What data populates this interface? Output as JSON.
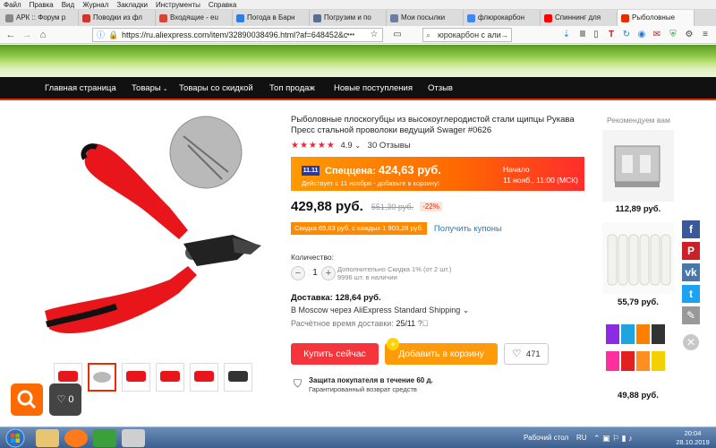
{
  "menubar": [
    "Файл",
    "Правка",
    "Вид",
    "Журнал",
    "Закладки",
    "Инструменты",
    "Справка"
  ],
  "tabs": [
    {
      "label": "АРК :: Форум р",
      "color": "#888888",
      "active": false
    },
    {
      "label": "Поводки из фл",
      "color": "#d0342c",
      "active": false
    },
    {
      "label": "Входящие - eu",
      "color": "#d44638",
      "active": false
    },
    {
      "label": "Погода в Барн",
      "color": "#2f7de1",
      "active": false
    },
    {
      "label": "Погрузим и по",
      "color": "#5a6f8f",
      "active": false
    },
    {
      "label": "Мои посылки",
      "color": "#6a7f9f",
      "active": false
    },
    {
      "label": "флюрокарбон",
      "color": "#4285f4",
      "active": false
    },
    {
      "label": "Спиннинг для",
      "color": "#ff0000",
      "active": false
    },
    {
      "label": "Рыболовные",
      "color": "#e62e04",
      "active": true
    }
  ],
  "browser": {
    "url": "https://ru.aliexpress.com/item/32890038496.html?af=648452&c",
    "search": "юрокарбон с али",
    "back": "←",
    "forward": "→",
    "home": "⌂",
    "more": "•••",
    "star": "☆"
  },
  "nav": [
    "Главная страница",
    "Товары",
    "Товары со скидкой",
    "Топ продаж",
    "Новые поступления",
    "Отзыв"
  ],
  "product": {
    "title": "Рыболовные плоскогубцы из высокоуглеродистой стали щипцы Рукава Пресс стальной проволоки ведущий Swager #0626",
    "stars": "★★★★★",
    "rating": "4.9",
    "reviews": "30 Отзывы",
    "promo_badge": "11.11",
    "promo_label": "Спеццена:",
    "promo_price": "424,63 руб.",
    "promo_sub": "Действует с 11 ноября - добавьте в корзину!",
    "promo_start_label": "Начало",
    "promo_start_date": "11 нояб., 11:00 (МСК)",
    "price": "429,88 руб.",
    "old_price": "551,30 руб.",
    "discount": "-22%",
    "coupon": "Скидка 65,63 руб. с каждых 1 903,28 руб.",
    "coupon_link": "Получить купоны",
    "qty_label": "Количество:",
    "qty_minus": "−",
    "qty_value": "1",
    "qty_plus": "+",
    "qty_note1": "Дополнительно Скидка 1% (от 2 шт.)",
    "qty_note2": "9996 шт. в наличии",
    "shipping_title": "Доставка: 128,64 руб.",
    "shipping_line": "В Moscow через AliExpress Standard Shipping ⌄",
    "eta_label": "Расчётное время доставки:",
    "eta_value": "25/11",
    "buy_now": "Купить сейчас",
    "add_to_cart": "Добавить в корзину",
    "wishlist_count": "471",
    "protect_title": "Защита покупателя в течение 60 д.",
    "protect_sub": "Гарантированный возврат средств"
  },
  "recommended": {
    "title": "Рекомендуем вам",
    "items": [
      {
        "price": "112,89 руб."
      },
      {
        "price": "55,79 руб."
      },
      {
        "price": "49,88 руб."
      }
    ]
  },
  "social": [
    {
      "name": "facebook",
      "glyph": "f",
      "color": "#3b5998"
    },
    {
      "name": "pinterest",
      "glyph": "P",
      "color": "#cb2027"
    },
    {
      "name": "vk",
      "glyph": "vk",
      "color": "#4a76a8"
    },
    {
      "name": "twitter",
      "glyph": "t",
      "color": "#1da1f2"
    },
    {
      "name": "edit",
      "glyph": "✎",
      "color": "#999999"
    }
  ],
  "floating": {
    "wishlist_count": "0"
  },
  "taskbar": {
    "desktop_label": "Рабочий стол",
    "lang": "RU",
    "time": "20:04",
    "date": "28.10.2019"
  }
}
